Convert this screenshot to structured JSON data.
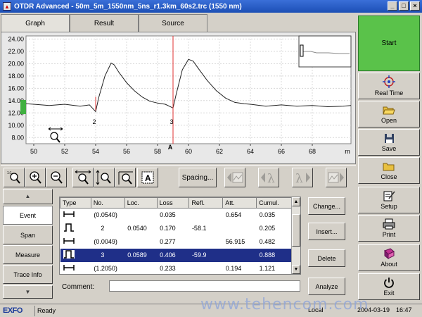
{
  "window": {
    "title": "OTDR Advanced - 50m_5m_1550nm_5ns_r1.3km_60s2.trc (1550 nm)"
  },
  "tabs": [
    {
      "label": "Graph"
    },
    {
      "label": "Result"
    },
    {
      "label": "Source"
    }
  ],
  "graph": {
    "y_ticks": [
      "24.00",
      "22.00",
      "20.00",
      "18.00",
      "16.00",
      "14.00",
      "12.00",
      "10.00",
      "8.00"
    ],
    "x_ticks": [
      "50",
      "52",
      "54",
      "56",
      "58",
      "60",
      "62",
      "64",
      "66",
      "68"
    ],
    "x_unit": "m",
    "marker_label": "A",
    "event_labels": [
      "2",
      "3"
    ],
    "trace_color": "#222222",
    "marker_color": "#e03030"
  },
  "chart_data": {
    "type": "line",
    "xlim": [
      49.5,
      70.5
    ],
    "ylim": [
      7,
      24.5
    ],
    "x": [
      49.5,
      50,
      51,
      52,
      53,
      53.6,
      54.0,
      54.2,
      54.6,
      55.0,
      55.2,
      55.5,
      56,
      56.5,
      57,
      57.5,
      58,
      58.5,
      59.0,
      59.2,
      59.6,
      60.0,
      60.3,
      60.7,
      61.2,
      61.8,
      62.4,
      63,
      63.6,
      64,
      65,
      66,
      67,
      68,
      69,
      70,
      70.5
    ],
    "y": [
      13.5,
      13.4,
      13.2,
      13.4,
      13.1,
      13.3,
      12.2,
      14.5,
      18.0,
      20.1,
      19.8,
      18.6,
      16.9,
      15.6,
      14.6,
      13.9,
      13.6,
      13.4,
      12.8,
      15.0,
      19.0,
      20.7,
      20.4,
      19.0,
      17.3,
      15.6,
      14.4,
      13.7,
      13.5,
      13.4,
      13.1,
      13.3,
      13.1,
      13.2,
      13.0,
      13.1,
      13.2
    ],
    "markers": [
      54.0,
      59.0
    ],
    "grid": true
  },
  "toolbar": {
    "spacing_label": "Spacing..."
  },
  "sidenav": {
    "items": [
      {
        "label": "Event"
      },
      {
        "label": "Span"
      },
      {
        "label": "Measure"
      },
      {
        "label": "Trace Info"
      }
    ]
  },
  "events": {
    "headers": [
      "Type",
      "No.",
      "Loc.",
      "Loss",
      "Refl.",
      "Att.",
      "Cumul."
    ],
    "rows": [
      {
        "no": "(0.0540)",
        "loc": "",
        "loss": "0.035",
        "refl": "",
        "att": "0.654",
        "cumul": "0.035"
      },
      {
        "no": "2",
        "loc": "0.0540",
        "loss": "0.170",
        "refl": "-58.1",
        "att": "",
        "cumul": "0.205"
      },
      {
        "no": "(0.0049)",
        "loc": "",
        "loss": "0.277",
        "refl": "",
        "att": "56.915",
        "cumul": "0.482"
      },
      {
        "no": "3",
        "loc": "0.0589",
        "loss": "0.406",
        "refl": "-59.9",
        "att": "",
        "cumul": "0.888"
      },
      {
        "no": "(1.2050)",
        "loc": "",
        "loss": "0.233",
        "refl": "",
        "att": "0.194",
        "cumul": "1.121"
      }
    ]
  },
  "actions": {
    "change": "Change...",
    "insert": "Insert...",
    "delete": "Delete",
    "analyze": "Analyze"
  },
  "comment": {
    "label": "Comment:",
    "value": ""
  },
  "rightbar": {
    "start": "Start",
    "realtime": "Real Time",
    "open": "Open",
    "save": "Save",
    "close": "Close",
    "setup": "Setup",
    "print": "Print",
    "about": "About",
    "exit": "Exit"
  },
  "status": {
    "logo": "EXFO",
    "ready": "Ready",
    "mode": "Local",
    "date": "2004-03-19",
    "time": "16:47"
  },
  "watermark": "www.tehencom.com"
}
